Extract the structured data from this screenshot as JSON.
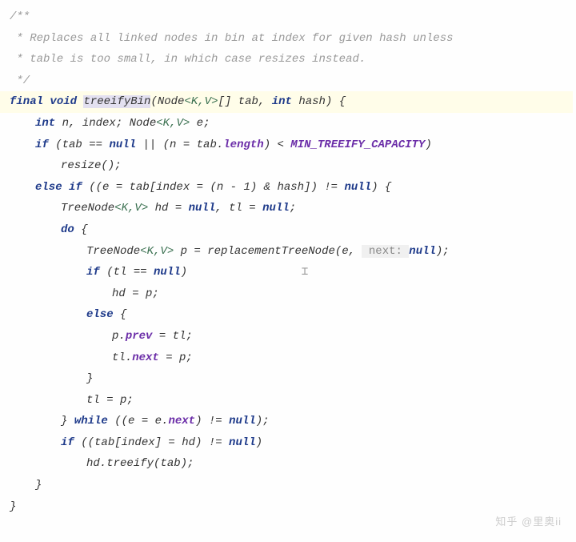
{
  "comment": {
    "l1": "/**",
    "l2": " * Replaces all linked nodes in bin at index for given hash unless",
    "l3": " * table is too small, in which case resizes instead.",
    "l4": " */"
  },
  "kw": {
    "final": "final",
    "void": "void",
    "int": "int",
    "if": "if",
    "else": "else",
    "elseif": "else if",
    "null": "null",
    "do": "do",
    "while": "while"
  },
  "sig": {
    "method": "treeifyBin",
    "p1a": "(Node",
    "gen": "<K,V>",
    "p1b": "[] tab, ",
    "p2": " hash) {"
  },
  "decl": {
    "a": " n, index; Node",
    "gen": "<K,V>",
    "b": " e;"
  },
  "cond1": {
    "a": " (tab == ",
    "b": " || (n = tab.",
    "len": "length",
    "c": ") < ",
    "mtc": "MIN_TREEIFY_CAPACITY",
    "d": ")"
  },
  "resize": "resize();",
  "cond2": {
    "a": " ((e = tab[index = (n - 1) & hash]) != ",
    "b": ") {"
  },
  "tn": {
    "a": "TreeNode",
    "gen": "<K,V>",
    "b": " hd = ",
    "c": ", tl = ",
    "d": ";"
  },
  "doopen": " {",
  "p": {
    "a": "TreeNode",
    "gen": "<K,V>",
    "b": " p = replacementTreeNode(e, ",
    "hint": " next: ",
    "c": ");"
  },
  "cursor": "⌶",
  "iftl": {
    "a": " (tl == ",
    "b": ")"
  },
  "hdp": "hd = p;",
  "elseopen": " {",
  "pprev": {
    "a": "p.",
    "field": "prev",
    "b": " = tl;"
  },
  "tlnext": {
    "a": "tl.",
    "field": "next",
    "b": " = p;"
  },
  "closebrace": "}",
  "tlp": "tl = p;",
  "whilec": {
    "a": "} ",
    "b": " ((e = e.",
    "field": "next",
    "c": ") != ",
    "d": ");"
  },
  "iftab": {
    "a": " ((tab[index] = hd) != ",
    "b": ")"
  },
  "treeify": "hd.treeify(tab);",
  "watermark": "知乎 @里奥ii"
}
